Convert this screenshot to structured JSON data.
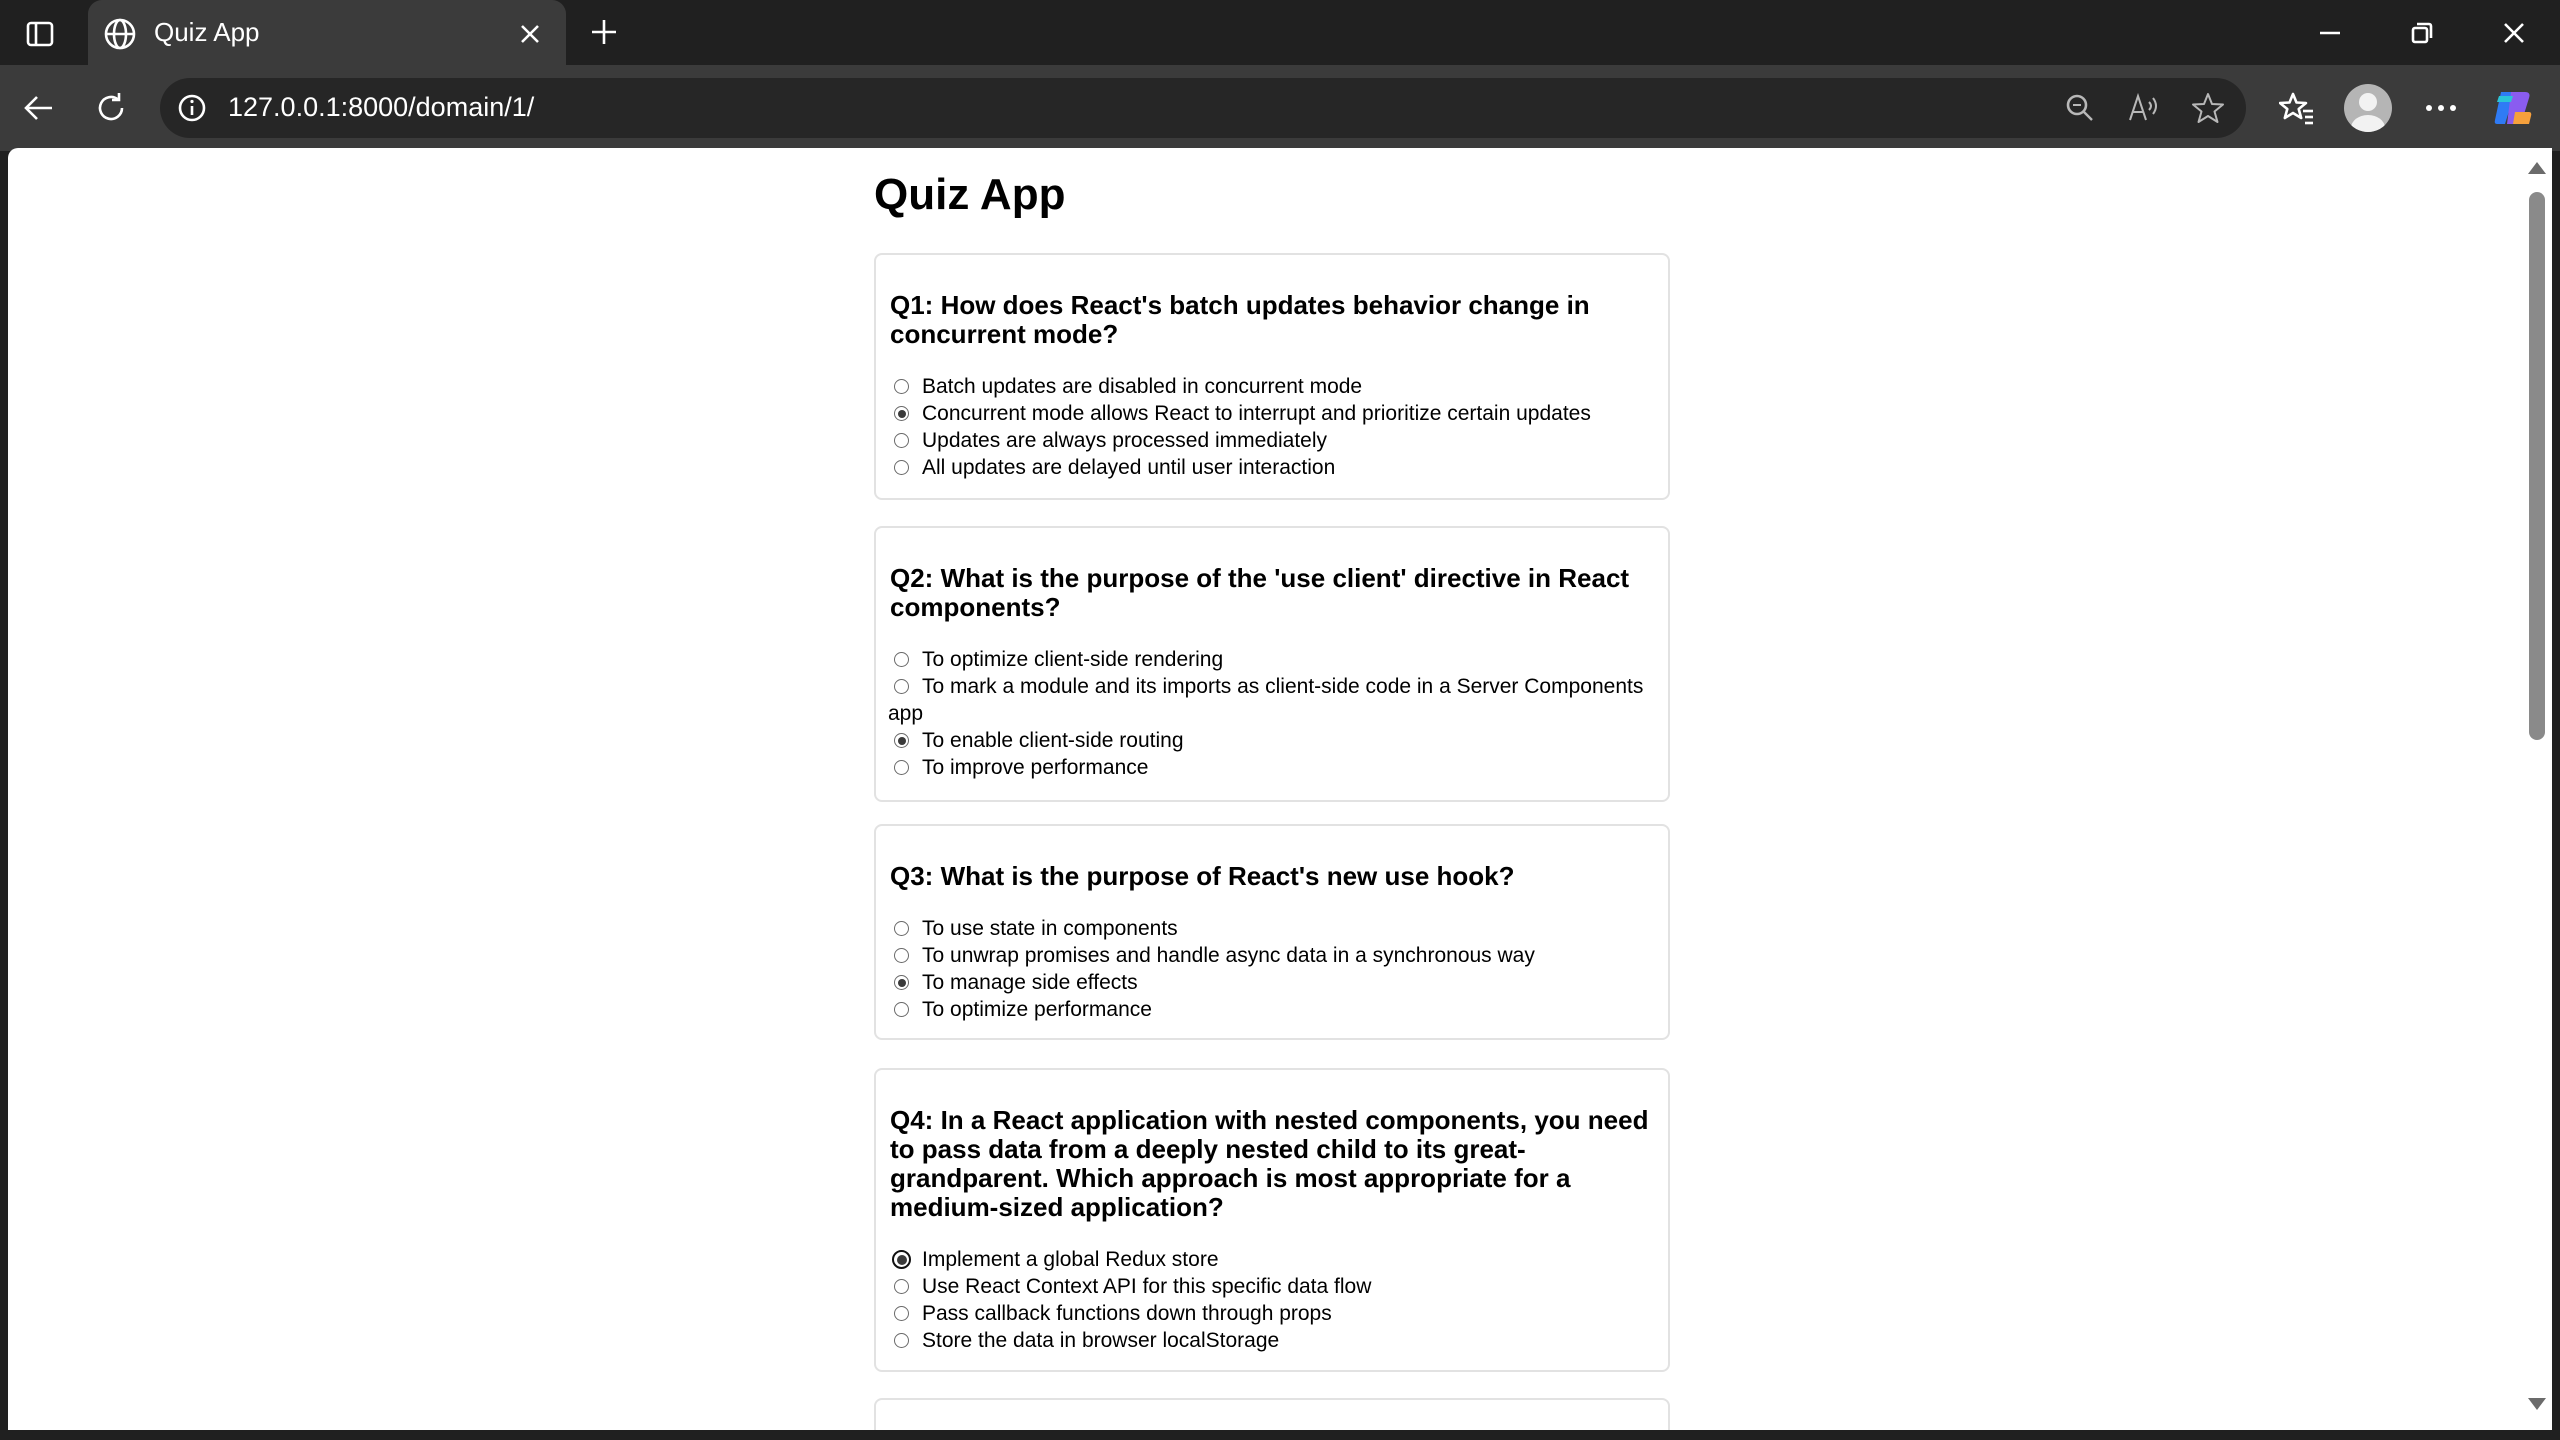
{
  "browser": {
    "tab_title": "Quiz App",
    "url": "127.0.0.1:8000/domain/1/",
    "icons": {
      "tab_actions": "tab-actions-icon",
      "favicon": "globe-icon",
      "close_tab": "close-icon",
      "new_tab": "plus-icon",
      "minimize": "minimize-icon",
      "restore": "restore-icon",
      "close_window": "close-icon",
      "back": "back-arrow-icon",
      "refresh": "refresh-icon",
      "site_info": "info-icon",
      "zoom_out": "zoom-out-icon",
      "read_aloud": "read-aloud-icon",
      "favorite": "star-icon",
      "favorites": "favorites-icon",
      "profile": "avatar-icon",
      "more": "more-icon",
      "copilot": "copilot-icon"
    }
  },
  "page": {
    "title": "Quiz App",
    "questions": [
      {
        "text": "Q1: How does React's batch updates behavior change in concurrent mode?",
        "options": [
          "Batch updates are disabled in concurrent mode",
          "Concurrent mode allows React to interrupt and prioritize certain updates",
          "Updates are always processed immediately",
          "All updates are delayed until user interaction"
        ],
        "selected_index": 1
      },
      {
        "text": "Q2: What is the purpose of the 'use client' directive in React components?",
        "options": [
          "To optimize client-side rendering",
          "To mark a module and its imports as client-side code in a Server Components app",
          "To enable client-side routing",
          "To improve performance"
        ],
        "selected_index": 2
      },
      {
        "text": "Q3: What is the purpose of React's new use hook?",
        "options": [
          "To use state in components",
          "To unwrap promises and handle async data in a synchronous way",
          "To manage side effects",
          "To optimize performance"
        ],
        "selected_index": 2
      },
      {
        "text": "Q4: In a React application with nested components, you need to pass data from a deeply nested child to its great-grandparent. Which approach is most appropriate for a medium-sized application?",
        "options": [
          "Implement a global Redux store",
          "Use React Context API for this specific data flow",
          "Pass callback functions down through props",
          "Store the data in browser localStorage"
        ],
        "selected_index": 0
      }
    ]
  }
}
